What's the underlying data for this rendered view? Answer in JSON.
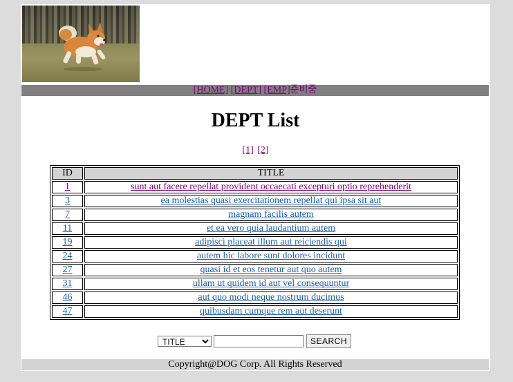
{
  "banner": {
    "image_alt": "corgi running on grass"
  },
  "nav": {
    "home": "[HOME]",
    "dept": "[DEPT]",
    "emp": "[EMP]",
    "readying": "준비중"
  },
  "page_title": "DEPT List",
  "pager": [
    "[1]",
    "[2]"
  ],
  "table": {
    "headers": {
      "id": "ID",
      "title": "TITLE"
    },
    "rows": [
      {
        "id": "1",
        "title": "sunt aut facere repellat provident occaecati excepturi optio reprehenderit"
      },
      {
        "id": "3",
        "title": "ea molestias quasi exercitationem repellat qui ipsa sit aut"
      },
      {
        "id": "7",
        "title": "magnam facilis autem"
      },
      {
        "id": "11",
        "title": "et ea vero quia laudantium autem"
      },
      {
        "id": "19",
        "title": "adipisci placeat illum aut reiciendis qui"
      },
      {
        "id": "24",
        "title": "autem hic labore sunt dolores incidunt"
      },
      {
        "id": "27",
        "title": "quasi id et eos tenetur aut quo autem"
      },
      {
        "id": "31",
        "title": "ullam ut quidem id aut vel consequuntur"
      },
      {
        "id": "46",
        "title": "aut quo modi neque nostrum ducimus"
      },
      {
        "id": "47",
        "title": "quibusdam cumque rem aut deserunt"
      }
    ]
  },
  "search": {
    "select_value": "TITLE",
    "options": [
      "TITLE"
    ],
    "input_value": "",
    "button_label": "SEARCH"
  },
  "footer": "Copyright@DOG Corp. All Rights Reserved",
  "colors": {
    "nav_bg": "#808080",
    "footer_bg": "#d3d3d3",
    "visited_link": "#800080",
    "link": "#1a5fb4"
  }
}
